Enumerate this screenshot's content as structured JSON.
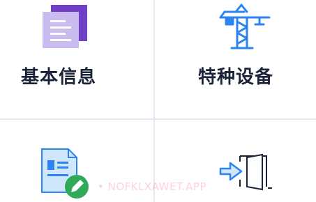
{
  "tiles": [
    {
      "label": "基本信息",
      "icon": "document-list-icon"
    },
    {
      "label": "特种设备",
      "icon": "tower-crane-icon"
    },
    {
      "label": "",
      "icon": "id-card-edit-icon"
    },
    {
      "label": "",
      "icon": "door-enter-icon"
    }
  ],
  "watermark": "• NOFKLXAWET.APP",
  "colors": {
    "purple_dark": "#6f3fc8",
    "purple_light": "#cbbcef",
    "blue": "#2b84ef",
    "blue_light": "#cfe6fb",
    "green": "#2faa59",
    "text": "#1b2338",
    "divider": "#e4e7ef"
  }
}
